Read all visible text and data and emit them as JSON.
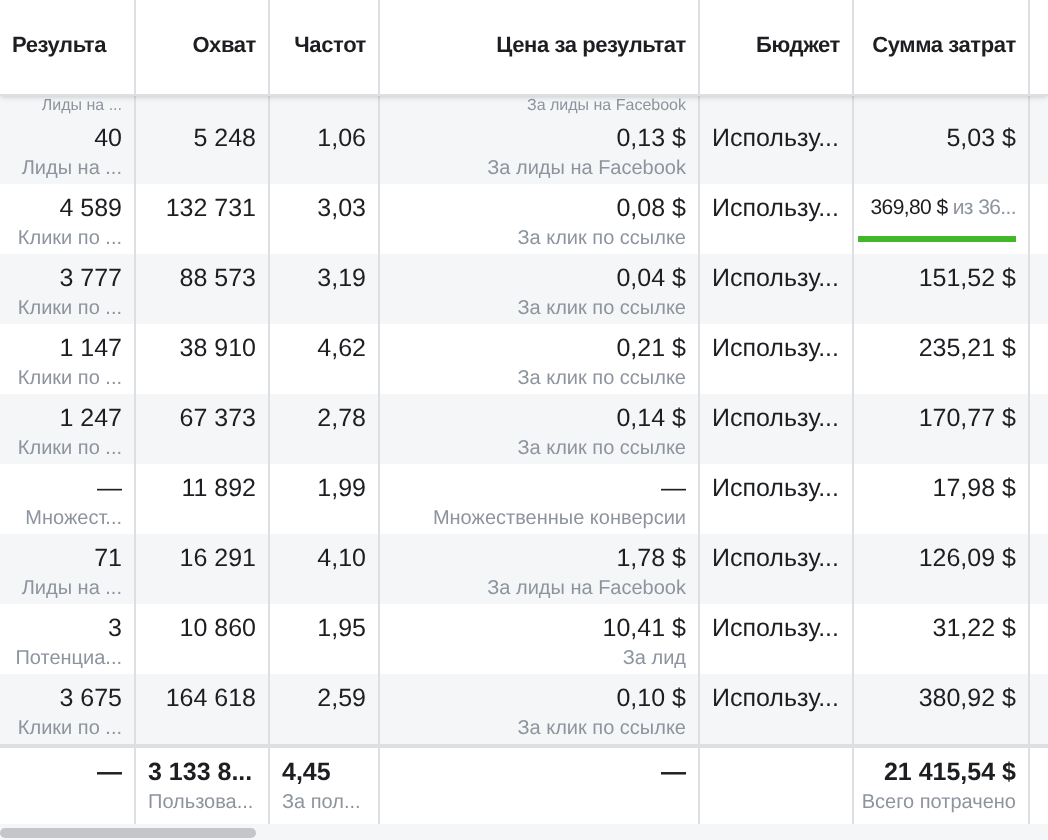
{
  "columns": [
    "Результа",
    "Охват",
    "Частот",
    "Цена за результат",
    "Бюджет",
    "Сумма затрат"
  ],
  "partial_row": {
    "result_sub": "Лиды на ...",
    "cost_sub": "За лиды на Facebook"
  },
  "rows": [
    {
      "result": "40",
      "result_sub": "Лиды на ...",
      "reach": "5 248",
      "frequency": "1,06",
      "cost": "0,13 $",
      "cost_sub": "За лиды на Facebook",
      "budget": "Использу...",
      "spend": "5,03 $"
    },
    {
      "result": "4 589",
      "result_sub": "Клики по ...",
      "reach": "132 731",
      "frequency": "3,03",
      "cost": "0,08 $",
      "cost_sub": "За клик по ссылке",
      "budget": "Использу...",
      "spend": "369,80 $",
      "spend_limit": "из 36...",
      "level": 1
    },
    {
      "result": "3 777",
      "result_sub": "Клики по ...",
      "reach": "88 573",
      "frequency": "3,19",
      "cost": "0,04 $",
      "cost_sub": "За клик по ссылке",
      "budget": "Использу...",
      "spend": "151,52 $"
    },
    {
      "result": "1 147",
      "result_sub": "Клики по ...",
      "reach": "38 910",
      "frequency": "4,62",
      "cost": "0,21 $",
      "cost_sub": "За клик по ссылке",
      "budget": "Использу...",
      "spend": "235,21 $"
    },
    {
      "result": "1 247",
      "result_sub": "Клики по ...",
      "reach": "67 373",
      "frequency": "2,78",
      "cost": "0,14 $",
      "cost_sub": "За клик по ссылке",
      "budget": "Использу...",
      "spend": "170,77 $"
    },
    {
      "result": "—",
      "result_sub": "Множест...",
      "reach": "11 892",
      "frequency": "1,99",
      "cost": "—",
      "cost_sub": "Множественные конверсии",
      "budget": "Использу...",
      "spend": "17,98 $"
    },
    {
      "result": "71",
      "result_sub": "Лиды на ...",
      "reach": "16 291",
      "frequency": "4,10",
      "cost": "1,78 $",
      "cost_sub": "За лиды на Facebook",
      "budget": "Использу...",
      "spend": "126,09 $"
    },
    {
      "result": "3",
      "result_sub": "Потенциа...",
      "reach": "10 860",
      "frequency": "1,95",
      "cost": "10,41 $",
      "cost_sub": "За лид",
      "budget": "Использу...",
      "spend": "31,22 $"
    },
    {
      "result": "3 675",
      "result_sub": "Клики по ...",
      "reach": "164 618",
      "frequency": "2,59",
      "cost": "0,10 $",
      "cost_sub": "За клик по ссылке",
      "budget": "Использу...",
      "spend": "380,92 $"
    }
  ],
  "totals": {
    "result": "—",
    "reach": "3 133 8...",
    "reach_sub": "Пользова...",
    "frequency": "4,45",
    "frequency_sub": "За пол...",
    "cost": "—",
    "spend": "21 415,54 $",
    "spend_sub": "Всего потрачено"
  }
}
